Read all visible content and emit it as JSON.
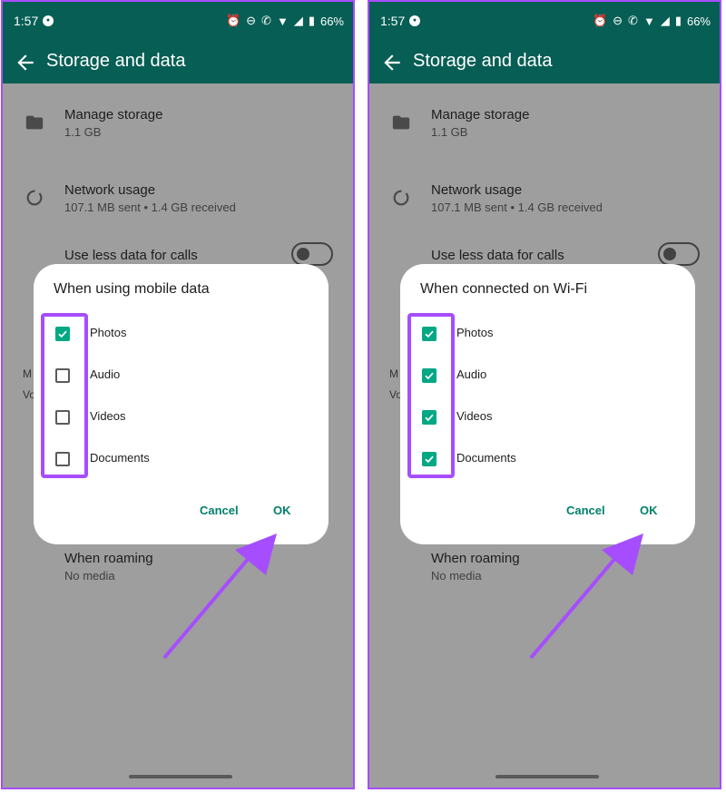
{
  "status_bar": {
    "time": "1:57",
    "battery": "66%"
  },
  "app_bar": {
    "title": "Storage and data"
  },
  "rows": {
    "manage_storage": {
      "title": "Manage storage",
      "subtitle": "1.1 GB"
    },
    "network_usage": {
      "title": "Network usage",
      "subtitle": "107.1 MB sent • 1.4 GB received"
    },
    "less_data_calls": {
      "title": "Use less data for calls",
      "enabled": false
    },
    "roaming": {
      "title": "When roaming",
      "subtitle": "No media"
    }
  },
  "clipped_text": {
    "m": "M",
    "vo": "Vo"
  },
  "dialogs": [
    {
      "title": "When using mobile data",
      "options": [
        {
          "label": "Photos",
          "checked": true
        },
        {
          "label": "Audio",
          "checked": false
        },
        {
          "label": "Videos",
          "checked": false
        },
        {
          "label": "Documents",
          "checked": false
        }
      ],
      "cancel_label": "Cancel",
      "ok_label": "OK"
    },
    {
      "title": "When connected on Wi-Fi",
      "options": [
        {
          "label": "Photos",
          "checked": true
        },
        {
          "label": "Audio",
          "checked": true
        },
        {
          "label": "Videos",
          "checked": true
        },
        {
          "label": "Documents",
          "checked": true
        }
      ],
      "cancel_label": "Cancel",
      "ok_label": "OK"
    }
  ],
  "colors": {
    "header": "#075e54",
    "accent": "#00a884",
    "highlight": "#a64dff",
    "scrim": "#9e9e9e"
  }
}
